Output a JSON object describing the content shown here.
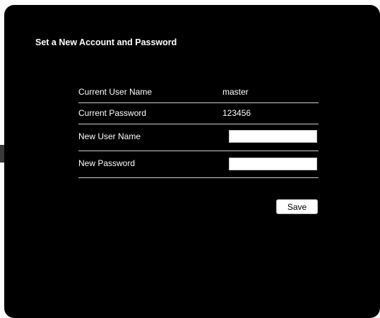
{
  "page": {
    "title": "Set a New Account and Password"
  },
  "form": {
    "current_user_name": {
      "label": "Current User Name",
      "value": "master"
    },
    "current_password": {
      "label": "Current Password",
      "value": "123456"
    },
    "new_user_name": {
      "label": "New User Name",
      "value": "",
      "placeholder": ""
    },
    "new_password": {
      "label": "New Password",
      "value": "",
      "placeholder": ""
    },
    "save_label": "Save"
  },
  "colors": {
    "panel_background": "#000000",
    "text": "#ffffff",
    "divider": "#cfcfcf",
    "input_background": "#ffffff"
  }
}
